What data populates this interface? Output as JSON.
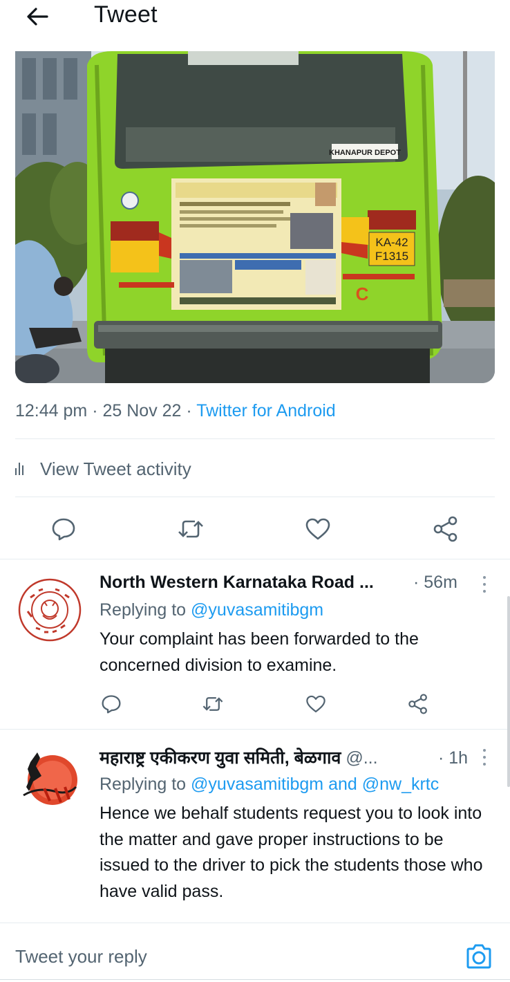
{
  "header": {
    "title": "Tweet",
    "back_icon": "arrow-left-icon"
  },
  "media": {
    "plate_line1": "KA-42",
    "plate_line2": "F1315",
    "depot_sign": "KHANAPUR DEPOT",
    "letter": "C"
  },
  "tweet": {
    "time": "12:44 pm",
    "date": "25 Nov 22",
    "separator": "·",
    "source": "Twitter for Android",
    "view_activity": "View Tweet activity"
  },
  "replies": [
    {
      "name": "North Western Karnataka Road ...",
      "handle": "",
      "time": "· 56m",
      "replying_prefix": "Replying to",
      "replying_to": "@yuvasamitibgm",
      "text": "Your complaint has been forwarded to the concerned division to examine."
    },
    {
      "name": "महाराष्ट्र एकीकरण युवा समिती, बेळगाव",
      "handle": "@...",
      "time": "· 1h",
      "replying_prefix": "Replying to",
      "replying_to": "@yuvasamitibgm and @nw_krtc",
      "text": "Hence we behalf students request you to look into the matter and gave proper instructions to be issued to the driver to pick the students those who have valid pass."
    }
  ],
  "compose": {
    "placeholder": "Tweet your reply"
  },
  "colors": {
    "accent": "#1d9bf0",
    "text": "#0f1419",
    "secondary": "#536471",
    "divider": "#e6ecf0",
    "bus_green": "#8fd42a"
  }
}
